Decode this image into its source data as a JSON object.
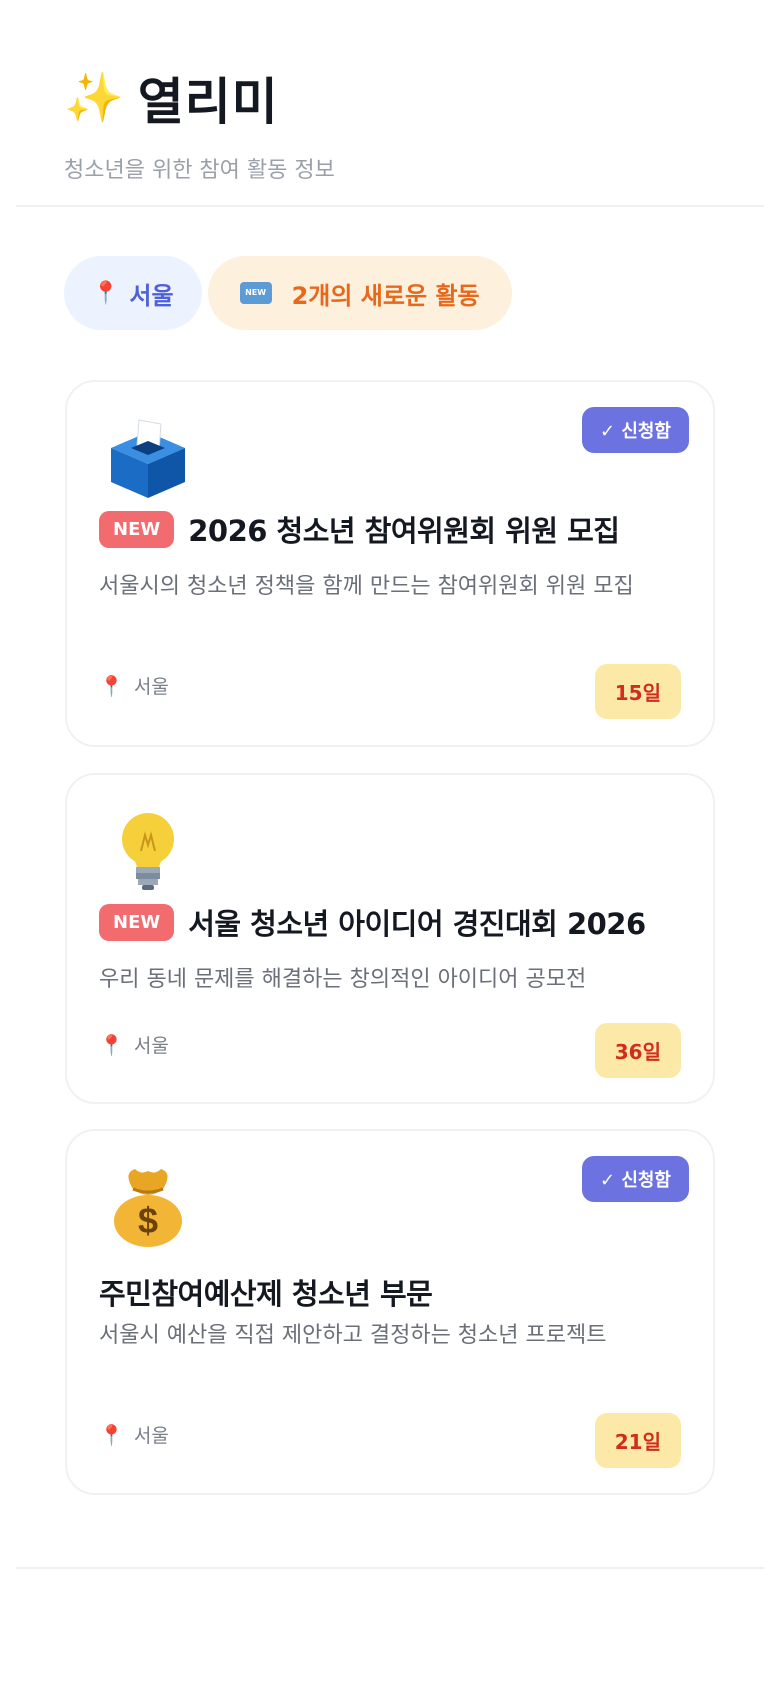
{
  "header": {
    "icon": "sparkles-icon",
    "title": "열리미",
    "subtitle": "청소년을 위한 참여 활동 정보"
  },
  "chips": {
    "location_label": "서울",
    "new_activities_label": "2개의 새로운 활동",
    "new_icon_text": "NEW"
  },
  "cards": [
    {
      "icon": "ballot-box-icon",
      "applied_label": "✓ 신청함",
      "new_badge": "NEW",
      "title": "2026 청소년 참여위원회 위원 모집",
      "description": "서울시의 청소년 정책을 함께 만드는 참여위원회 위원 모집",
      "location": "서울",
      "days_left": "15일"
    },
    {
      "icon": "light-bulb-icon",
      "applied_label": null,
      "new_badge": "NEW",
      "title": "서울 청소년 아이디어 경진대회 2026",
      "description": "우리 동네 문제를 해결하는 창의적인 아이디어 공모전",
      "location": "서울",
      "days_left": "36일"
    },
    {
      "icon": "money-bag-icon",
      "applied_label": "✓ 신청함",
      "new_badge": null,
      "title": "주민참여예산제 청소년 부문",
      "description": "서울시 예산을 직접 제안하고 결정하는 청소년 프로젝트",
      "location": "서울",
      "days_left": "21일"
    }
  ],
  "colors": {
    "accent": "#6c72e0",
    "new_badge": "#f26b6f",
    "dday_bg": "#fde9a7",
    "dday_text": "#d02c20",
    "location_chip_text": "#4f61d6",
    "new_chip_text": "#e7681a"
  }
}
